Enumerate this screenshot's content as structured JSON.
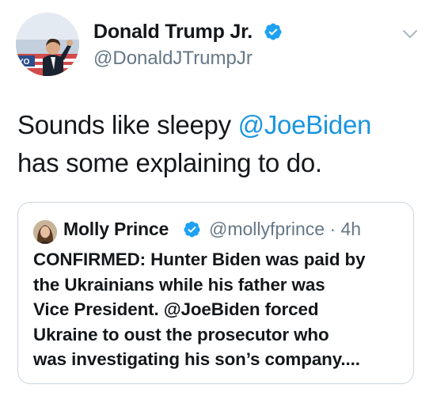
{
  "tweet": {
    "author_name": "Donald Trump Jr.",
    "author_handle": "@DonaldJTrumpJr",
    "text_part1": "Sounds like sleepy ",
    "mention": "@JoeBiden",
    "text_line2": "has some explaining to do."
  },
  "quoted_tweet": {
    "author_name": "Molly Prince",
    "author_handle": "@mollyfprince",
    "time": "· 4h",
    "lines": [
      "CONFIRMED: Hunter Biden was paid by",
      "the Ukrainians while his father was",
      "Vice President. @JoeBiden forced",
      "Ukraine to oust the prosecutor who",
      "was investigating his son’s company...."
    ]
  },
  "colors": {
    "mention": "#1b95e0",
    "verified_badge": "#1da1f2",
    "secondary_text": "#657786"
  },
  "icons": {
    "verified": "verified-icon",
    "menu": "chevron-down-icon"
  }
}
